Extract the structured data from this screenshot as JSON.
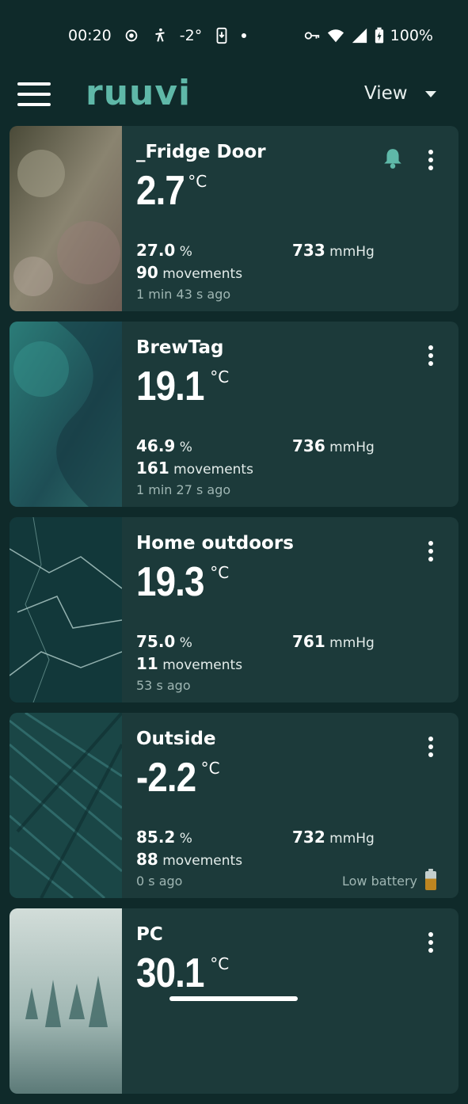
{
  "status_bar": {
    "time": "00:20",
    "weather_temp": "-2°",
    "battery": "100%",
    "icons": [
      "settings-cog-icon",
      "walking-icon",
      "download-icon",
      "dot-icon",
      "vpn-key-icon",
      "wifi-icon",
      "signal-icon",
      "battery-charging-icon"
    ]
  },
  "app_bar": {
    "menu_icon": "hamburger-icon",
    "logo": "ruuvi",
    "view_label": "View"
  },
  "colors": {
    "background": "#0f2a2a",
    "card": "#1c3a3a",
    "accent": "#5fb8a8",
    "low_battery": "#d08e1e"
  },
  "cards": [
    {
      "name": "_Fridge Door",
      "temperature": "2.7",
      "temp_unit": "°C",
      "humidity": "27.0",
      "humidity_unit": "%",
      "pressure": "733",
      "pressure_unit": "mmHg",
      "movements": "90",
      "movements_label": "movements",
      "updated": "1 min 43 s ago",
      "alert": true
    },
    {
      "name": "BrewTag",
      "temperature": "19.1",
      "temp_unit": "°C",
      "humidity": "46.9",
      "humidity_unit": "%",
      "pressure": "736",
      "pressure_unit": "mmHg",
      "movements": "161",
      "movements_label": "movements",
      "updated": "1 min 27 s ago"
    },
    {
      "name": "Home outdoors",
      "temperature": "19.3",
      "temp_unit": "°C",
      "humidity": "75.0",
      "humidity_unit": "%",
      "pressure": "761",
      "pressure_unit": "mmHg",
      "movements": "11",
      "movements_label": "movements",
      "updated": "53 s ago"
    },
    {
      "name": "Outside",
      "temperature": "-2.2",
      "temp_unit": "°C",
      "humidity": "85.2",
      "humidity_unit": "%",
      "pressure": "732",
      "pressure_unit": "mmHg",
      "movements": "88",
      "movements_label": "movements",
      "updated": "0 s ago",
      "low_battery": "Low battery"
    },
    {
      "name": "PC",
      "temperature": "30.1",
      "temp_unit": "°C"
    }
  ]
}
